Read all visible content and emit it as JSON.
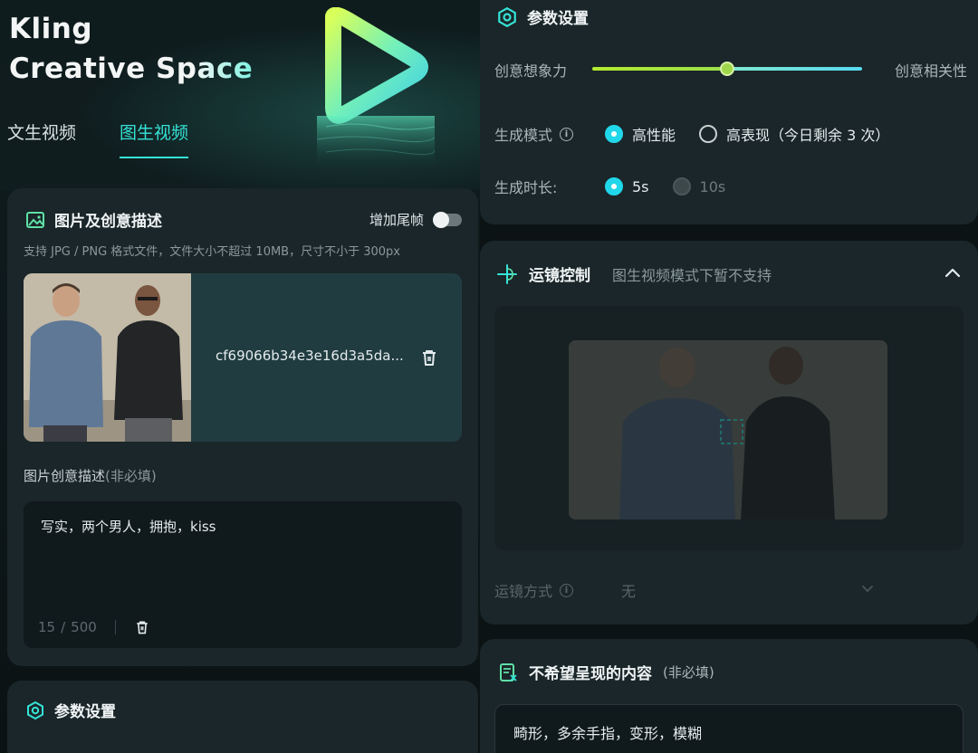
{
  "brand": {
    "line1": "Kling",
    "line2_a": "Creative",
    "line2_b": "Space"
  },
  "tabs": [
    {
      "label": "文生视频"
    },
    {
      "label": "图生视频",
      "active": true
    }
  ],
  "upload": {
    "title": "图片及创意描述",
    "toggle_label": "增加尾帧",
    "hint": "支持 JPG / PNG 格式文件，文件大小不超过 10MB，尺寸不小于 300px",
    "filename": "cf69066b34e3e16d3a5da...",
    "desc_label": "图片创意描述",
    "desc_optional": "(非必填)",
    "desc_value": "写实，两个男人，拥抱，kiss",
    "count": "15",
    "count_sep": "/",
    "max": "500"
  },
  "params_bottom": {
    "title": "参数设置"
  },
  "params": {
    "title": "参数设置",
    "slider_left": "创意想象力",
    "slider_right": "创意相关性",
    "slider_value": 0.5,
    "mode_label": "生成模式",
    "mode_options": [
      "高性能",
      "高表现（今日剩余 3 次）"
    ],
    "duration_label": "生成时长:",
    "duration_options": [
      "5s",
      "10s"
    ]
  },
  "camera": {
    "title": "运镜控制",
    "subtitle": "图生视频模式下暂不支持",
    "mode_label": "运镜方式",
    "mode_value": "无"
  },
  "negative": {
    "title": "不希望呈现的内容",
    "optional": "(非必填)",
    "value": "畸形，多余手指，变形，模糊"
  },
  "colors": {
    "accent": "#35e3d6",
    "radio_on": "#21d7ea",
    "card": "#1a2629",
    "bg": "#0d1417"
  }
}
